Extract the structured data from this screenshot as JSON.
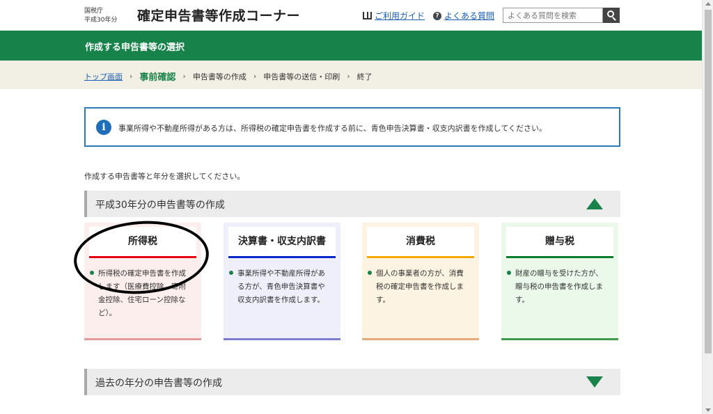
{
  "header": {
    "agency_line1": "国税庁",
    "agency_line2": "平成30年分",
    "title": "確定申告書等作成コーナー",
    "guide_link": "ご利用ガイド",
    "guide_icon": "book-icon",
    "faq_link": "よくある質問",
    "faq_icon": "question-circle-icon",
    "search_placeholder": "よくある質問を検索",
    "search_icon": "search-icon"
  },
  "page_title_bar": {
    "title": "作成する申告書等の選択",
    "color": "#17834a"
  },
  "breadcrumb": {
    "items": [
      "トップ画面",
      "事前確認",
      "申告書等の作成",
      "申告書等の送信・印刷",
      "終了"
    ],
    "separator": "›",
    "current_index": 1
  },
  "notice": {
    "icon": "info-icon",
    "icon_glyph": "i",
    "text": "事業所得や不動産所得がある方は、所得税の確定申告書を作成する前に、青色申告決算書・収支内訳書を作成してください。"
  },
  "instruction": "作成する申告書等と年分を選択してください。",
  "sections": [
    {
      "label": "平成30年分の申告書等の作成",
      "state": "expanded"
    },
    {
      "label": "過去の年分の申告書等の作成",
      "state": "collapsed"
    }
  ],
  "cards": [
    {
      "title": "所得税",
      "accent": "#e60012",
      "bg": "#fdeeee",
      "bottom": "#e29a9a",
      "desc_lines": [
        "所得税の確定申告書を作成",
        "します（医療費控除、寄附",
        "金控除、住宅ローン控除な",
        "ど）。"
      ]
    },
    {
      "title": "決算書・収支内訳書",
      "accent": "#0a28c8",
      "bg": "#efeffc",
      "bottom": "#7d7dd0",
      "desc_lines": [
        "事業所得や不動産所得があ",
        "る方が、青色申告決算書や",
        "収支内訳書を作成します。"
      ]
    },
    {
      "title": "消費税",
      "accent": "#f5a800",
      "bg": "#fdf3e2",
      "bottom": "#e3a97c",
      "desc_lines": [
        "個人の事業者の方が、消費",
        "税の確定申告書を作成しま",
        "す。"
      ]
    },
    {
      "title": "贈与税",
      "accent": "#0a7d2c",
      "bg": "#eaf9ea",
      "bottom": "#3f9a4a",
      "desc_lines": [
        "財産の贈与を受けた方が、",
        "贈与税の申告書を作成しま",
        "す。"
      ]
    }
  ]
}
